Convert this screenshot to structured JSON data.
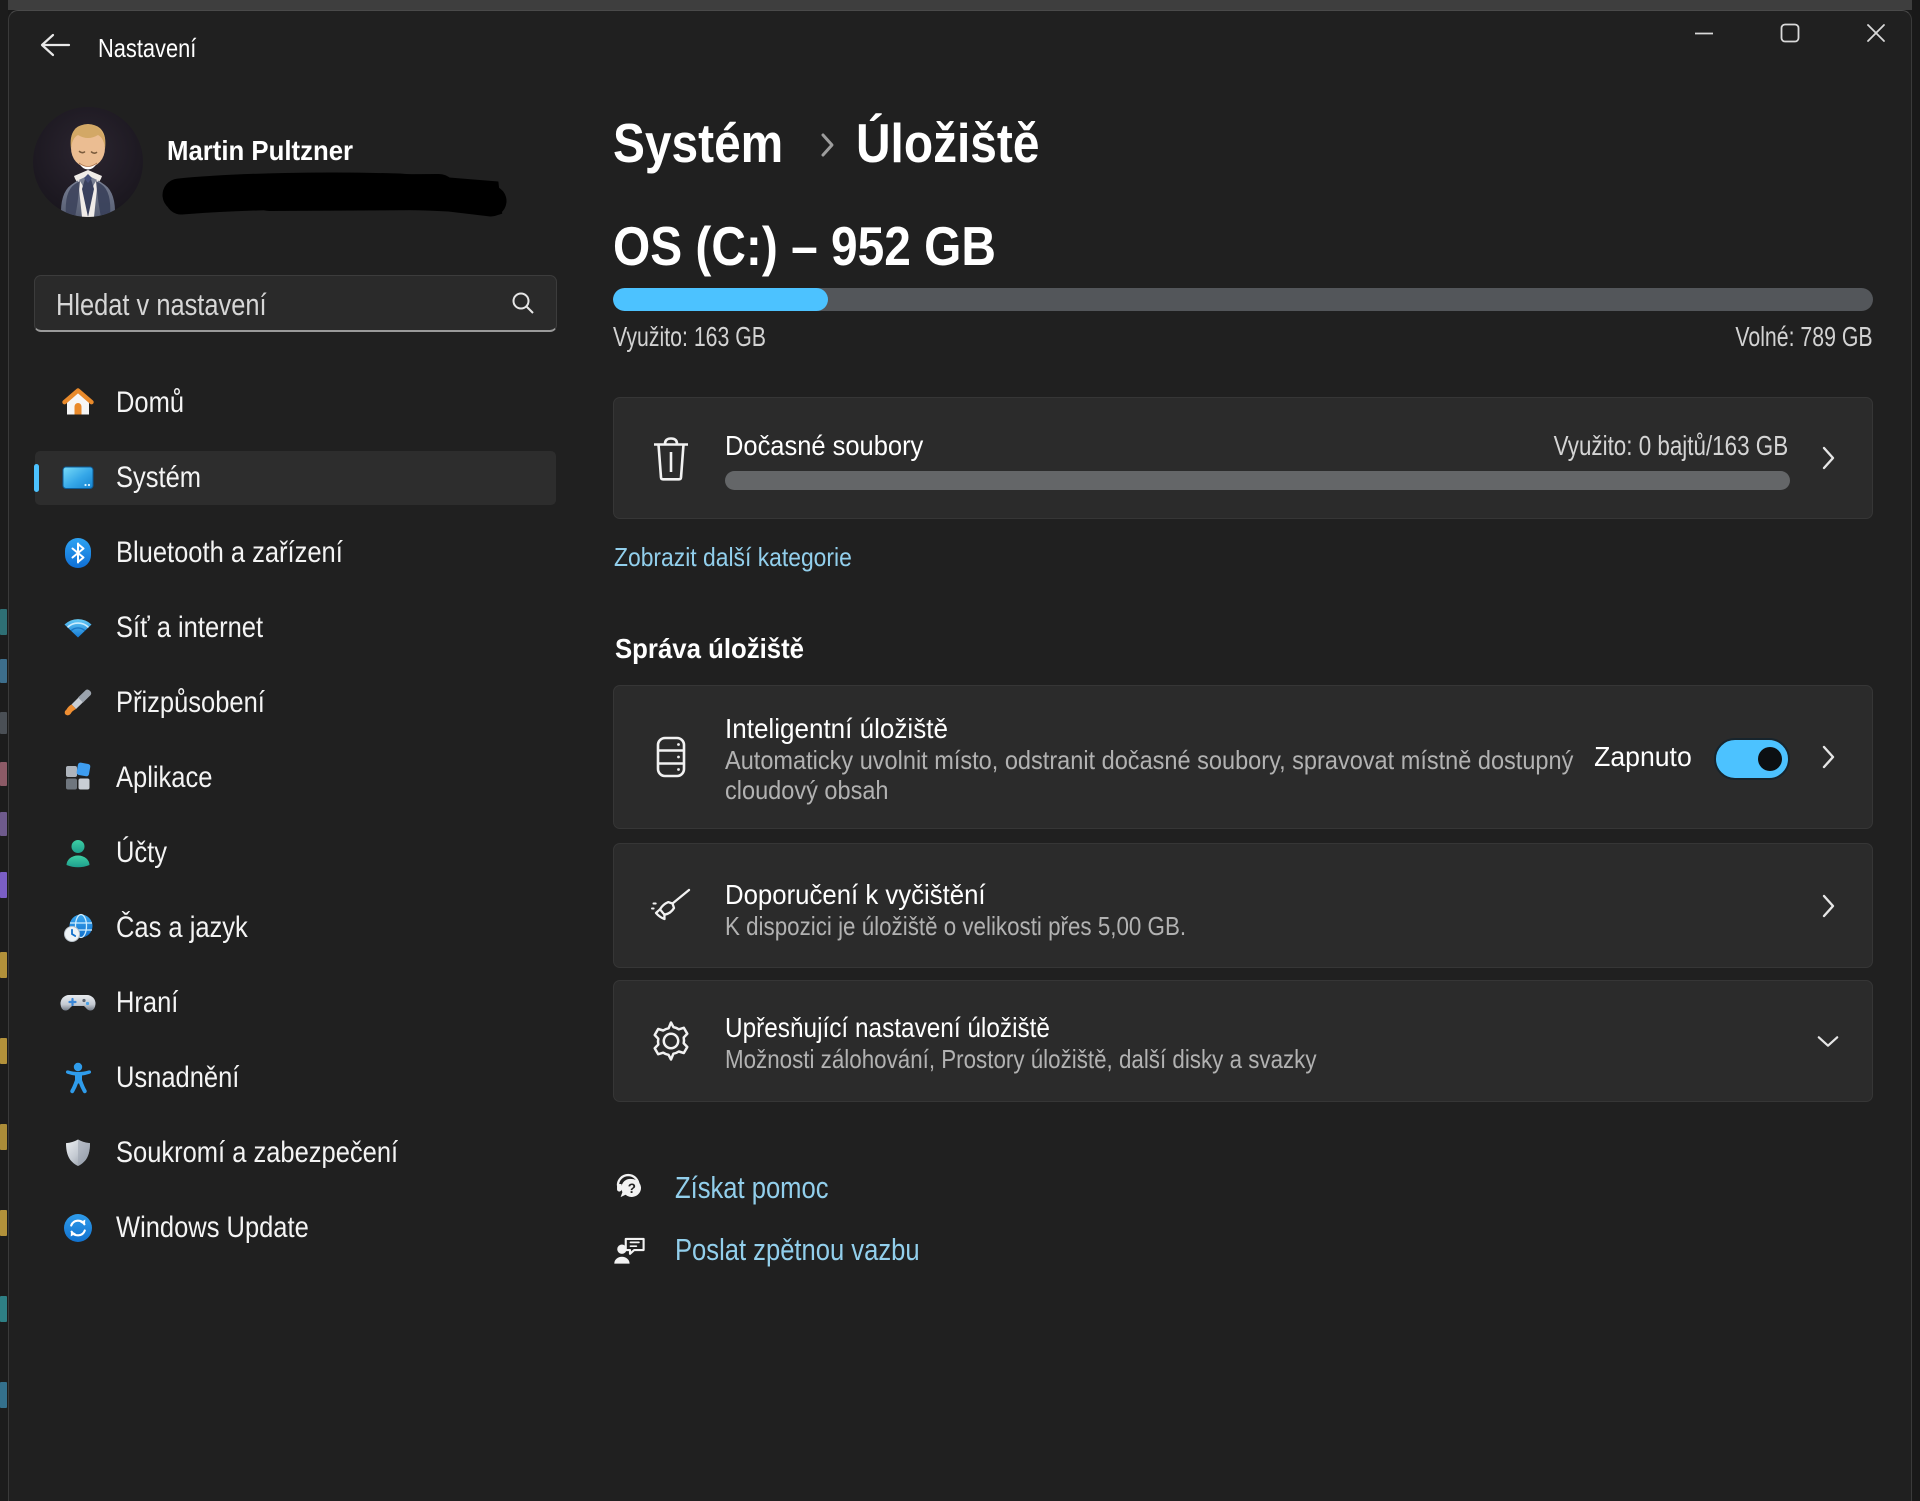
{
  "window": {
    "title": "Nastavení"
  },
  "titlebar": {
    "controls": [
      "minimize",
      "maximize",
      "close"
    ]
  },
  "profile": {
    "name": "Martin Pultzner"
  },
  "search": {
    "placeholder": "Hledat v nastavení"
  },
  "sidebar": {
    "items": [
      {
        "label": "Domů",
        "icon": "home-icon",
        "selected": false
      },
      {
        "label": "Systém",
        "icon": "system-icon",
        "selected": true
      },
      {
        "label": "Bluetooth a zařízení",
        "icon": "bluetooth-icon",
        "selected": false
      },
      {
        "label": "Síť a internet",
        "icon": "network-icon",
        "selected": false
      },
      {
        "label": "Přizpůsobení",
        "icon": "personalization-icon",
        "selected": false
      },
      {
        "label": "Aplikace",
        "icon": "apps-icon",
        "selected": false
      },
      {
        "label": "Účty",
        "icon": "accounts-icon",
        "selected": false
      },
      {
        "label": "Čas a jazyk",
        "icon": "time-language-icon",
        "selected": false
      },
      {
        "label": "Hraní",
        "icon": "gaming-icon",
        "selected": false
      },
      {
        "label": "Usnadnění",
        "icon": "accessibility-icon",
        "selected": false
      },
      {
        "label": "Soukromí a zabezpečení",
        "icon": "privacy-icon",
        "selected": false
      },
      {
        "label": "Windows Update",
        "icon": "windows-update-icon",
        "selected": false
      }
    ]
  },
  "content": {
    "breadcrumb": {
      "parent": "Systém",
      "separator": "›",
      "current": "Úložiště"
    },
    "drive": {
      "title": "OS (C:) – 952 GB",
      "used_label": "Využito: 163 GB",
      "free_label": "Volné: 789 GB",
      "used_percent": 17.1
    },
    "temp_card": {
      "title": "Dočasné soubory",
      "value": "Využito: 0 bajtů/163 GB",
      "used_percent": 0
    },
    "show_more_link": "Zobrazit další kategorie",
    "section_heading": "Správa úložiště",
    "storage_sense": {
      "title": "Inteligentní úložiště",
      "description": "Automaticky uvolnit místo, odstranit dočasné soubory, spravovat místně dostupný cloudový obsah",
      "toggle_label": "Zapnuto",
      "toggle_on": true
    },
    "cleanup_card": {
      "title": "Doporučení k vyčištění",
      "description": "K dispozici je úložiště o velikosti přes 5,00 GB."
    },
    "advanced_card": {
      "title": "Upřesňující nastavení úložiště",
      "description": "Možnosti zálohování, Prostory úložiště, další disky a svazky"
    },
    "help_link": "Získat pomoc",
    "feedback_link": "Poslat zpětnou vazbu"
  },
  "colors": {
    "accent": "#4cc2ff",
    "link": "#92cfec",
    "window_bg": "#202020",
    "card_bg": "#2b2b2b"
  }
}
